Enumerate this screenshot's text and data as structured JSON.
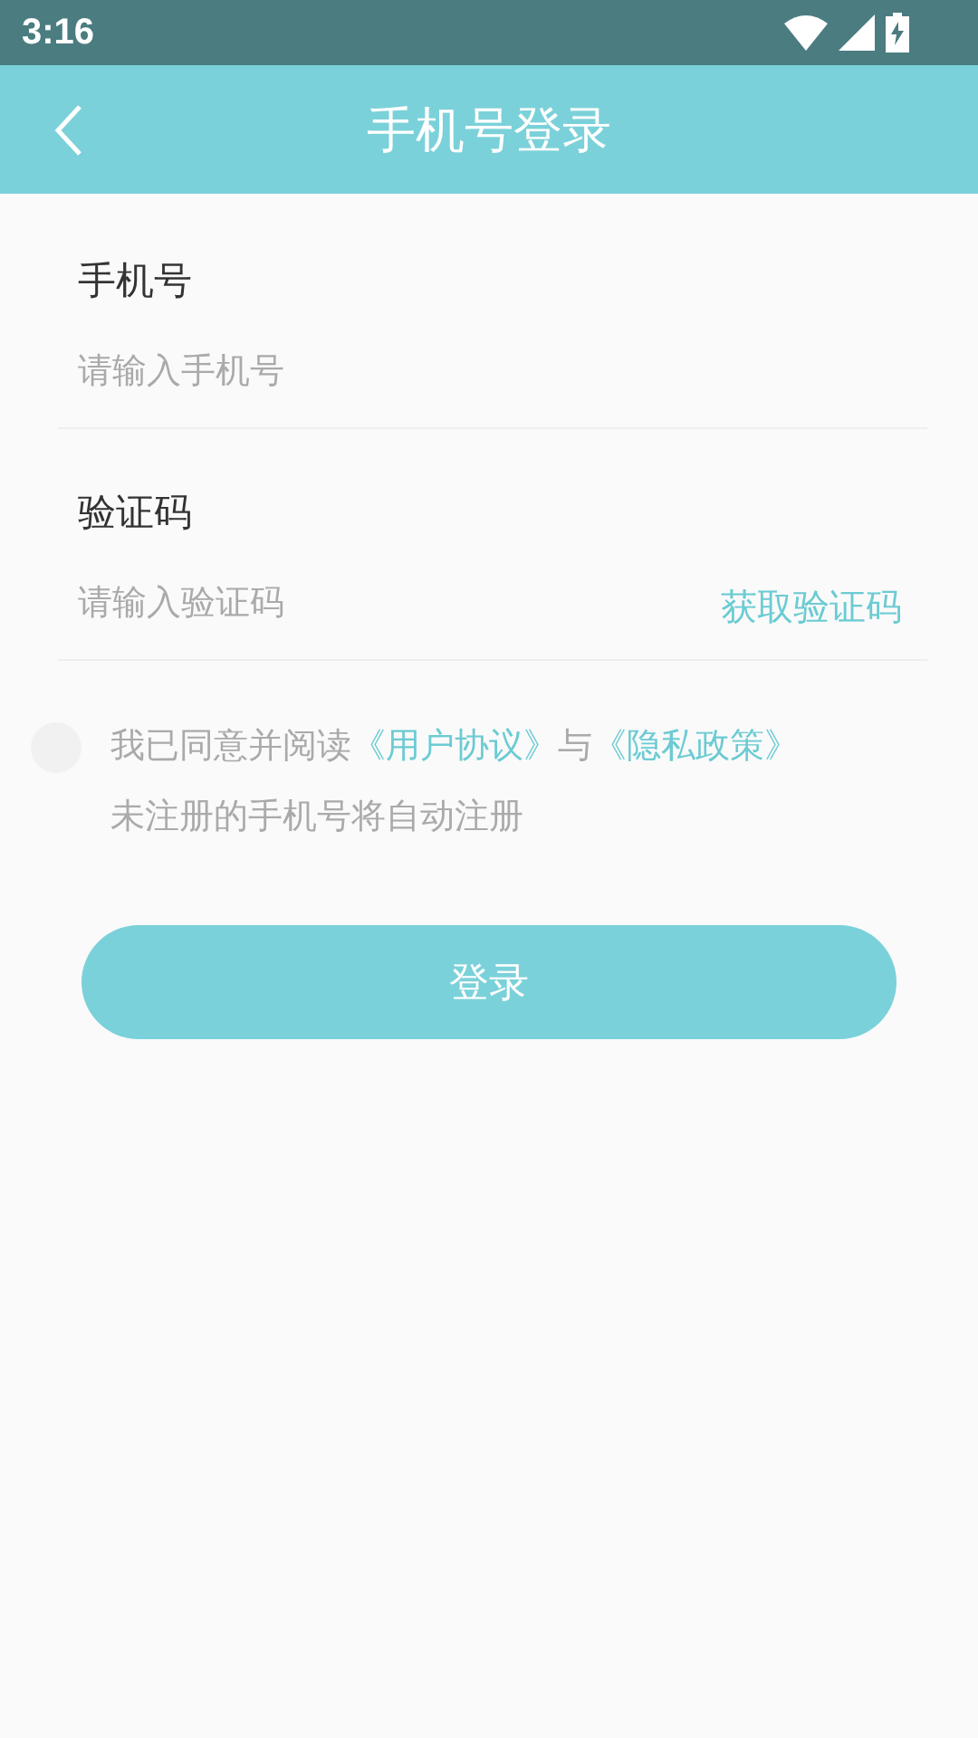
{
  "status_bar": {
    "time": "3:16"
  },
  "header": {
    "title": "手机号登录"
  },
  "phone": {
    "label": "手机号",
    "placeholder": "请输入手机号"
  },
  "code": {
    "label": "验证码",
    "placeholder": "请输入验证码",
    "action": "获取验证码"
  },
  "agreement": {
    "checked": false,
    "parts": [
      {
        "kind": "text",
        "text": "我已同意并阅读"
      },
      {
        "kind": "link",
        "text": "《用户协议》"
      },
      {
        "kind": "text",
        "text": "与"
      },
      {
        "kind": "link",
        "text": "《隐私政策》"
      }
    ],
    "note": "未注册的手机号将自动注册"
  },
  "login_button": "登录"
}
